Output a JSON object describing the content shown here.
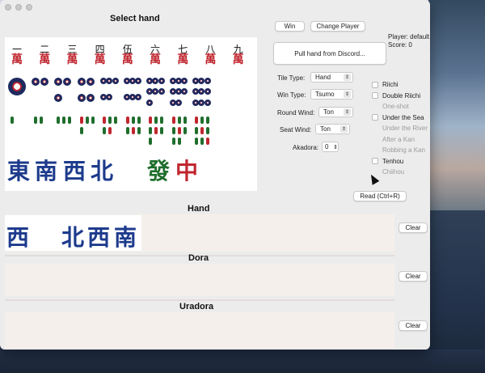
{
  "titles": {
    "select_hand": "Select hand",
    "hand": "Hand",
    "dora": "Dora",
    "uradora": "Uradora"
  },
  "buttons": {
    "win": "Win",
    "change_player": "Change Player",
    "pull_discord": "Pull hand from Discord...",
    "read": "Read (Ctrl+R)",
    "clear": "Clear"
  },
  "player": {
    "line": "Player: default",
    "score": "Score: 0"
  },
  "options": {
    "tile_type": {
      "label": "Tile Type:",
      "value": "Hand"
    },
    "win_type": {
      "label": "Win Type:",
      "value": "Tsumo"
    },
    "round_wind": {
      "label": "Round Wind:",
      "value": "Ton"
    },
    "seat_wind": {
      "label": "Seat Wind:",
      "value": "Ton"
    },
    "akadora": {
      "label": "Akadora:",
      "value": "0"
    }
  },
  "checks": [
    {
      "label": "Riichi",
      "enabled": true
    },
    {
      "label": "Double Riichi",
      "enabled": true
    },
    {
      "label": "One-shot",
      "enabled": false
    },
    {
      "label": "Under the Sea",
      "enabled": true
    },
    {
      "label": "Under the River",
      "enabled": false
    },
    {
      "label": "After a Kan",
      "enabled": false
    },
    {
      "label": "Robbing a Kan",
      "enabled": false
    },
    {
      "label": "Tenhou",
      "enabled": true
    },
    {
      "label": "Chiihou",
      "enabled": false
    }
  ],
  "tiles": {
    "man_numbers": [
      "一",
      "二",
      "三",
      "四",
      "伍",
      "六",
      "七",
      "八",
      "九"
    ],
    "man_suffix": "萬",
    "winds": [
      "東",
      "南",
      "西",
      "北"
    ],
    "dragons": [
      "發",
      "中"
    ]
  },
  "hand_tiles": [
    "西",
    "北",
    "西",
    "南"
  ],
  "colors": {
    "tile_blue": "#1d3b8c",
    "tile_red": "#c0262f",
    "tile_green": "#1f6e2c",
    "panel": "#f5efec"
  }
}
